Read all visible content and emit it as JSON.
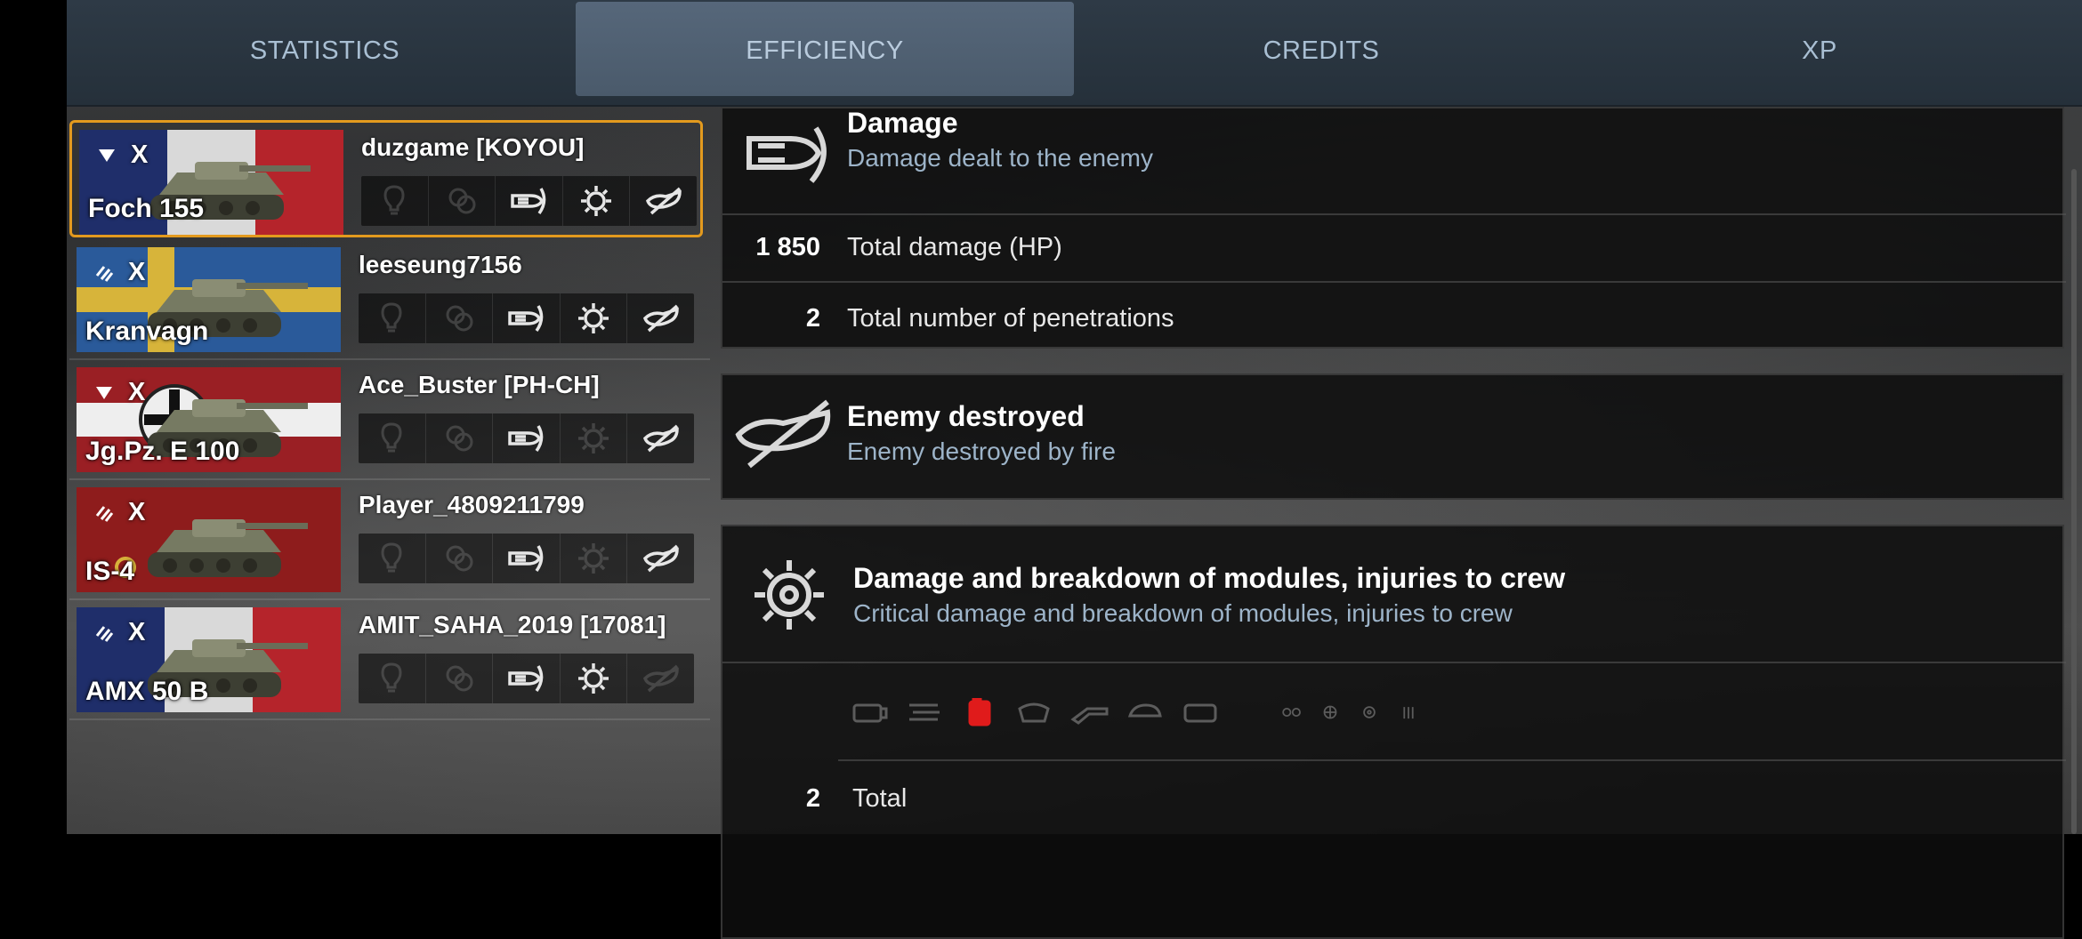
{
  "tabs": [
    {
      "label": "STATISTICS",
      "active": false
    },
    {
      "label": "EFFICIENCY",
      "active": true
    },
    {
      "label": "CREDITS",
      "active": false
    },
    {
      "label": "XP",
      "active": false
    }
  ],
  "players": [
    {
      "name": "duzgame [KOYOU]",
      "tank": "Foch 155",
      "tier": "X",
      "class": "tank-destroyer",
      "flag": "france",
      "selected": true,
      "badges": {
        "spotted": false,
        "assist": false,
        "damage": true,
        "modules": true,
        "destroyed": true
      }
    },
    {
      "name": "leeseung7156",
      "tank": "Kranvagn",
      "tier": "X",
      "class": "heavy-tank",
      "flag": "sweden",
      "selected": false,
      "badges": {
        "spotted": false,
        "assist": false,
        "damage": true,
        "modules": true,
        "destroyed": true
      }
    },
    {
      "name": "Ace_Buster [PH-CH]",
      "tank": "Jg.Pz. E 100",
      "tier": "X",
      "class": "tank-destroyer",
      "flag": "germany",
      "selected": false,
      "badges": {
        "spotted": false,
        "assist": false,
        "damage": true,
        "modules": false,
        "destroyed": true
      }
    },
    {
      "name": "Player_4809211799",
      "tank": "IS-4",
      "tier": "X",
      "class": "heavy-tank",
      "flag": "ussr",
      "selected": false,
      "badges": {
        "spotted": false,
        "assist": false,
        "damage": true,
        "modules": false,
        "destroyed": true
      }
    },
    {
      "name": "AMIT_SAHA_2019 [17081]",
      "tank": "AMX 50 B",
      "tier": "X",
      "class": "heavy-tank",
      "flag": "france",
      "selected": false,
      "badges": {
        "spotted": false,
        "assist": false,
        "damage": true,
        "modules": true,
        "destroyed": false
      }
    }
  ],
  "sections": {
    "damage": {
      "icon": "shell-damage-icon",
      "title": "Damage",
      "subtitle": "Damage dealt to the enemy",
      "rows": [
        {
          "value": "1 850",
          "label": "Total damage (HP)"
        },
        {
          "value": "2",
          "label": "Total number of penetrations"
        }
      ]
    },
    "destroyed": {
      "icon": "destroyed-tank-icon",
      "title": "Enemy destroyed",
      "subtitle": "Enemy destroyed by fire"
    },
    "modules": {
      "icon": "gear-module-icon",
      "title": "Damage and breakdown of modules, injuries to crew",
      "subtitle": "Critical damage and breakdown of modules, injuries to crew",
      "module_icons": [
        "engine-icon",
        "ammo-rack-icon",
        "fuel-tank-icon",
        "radio-icon",
        "gun-icon",
        "turret-icon",
        "tracks-icon",
        "optics-icon",
        "commander-icon",
        "gunner-icon",
        "loader-icon"
      ],
      "hit_module": "fuel-tank-icon",
      "total": {
        "value": "2",
        "label": "Total"
      }
    }
  },
  "colors": {
    "accent_selected": "#e39a1e",
    "subtitle": "#9db4c9",
    "hit": "#e01b1b"
  }
}
